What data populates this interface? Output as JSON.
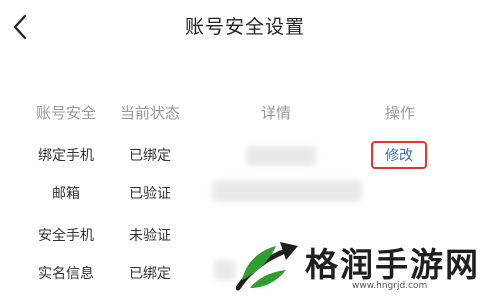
{
  "header": {
    "title": "账号安全设置",
    "back_icon": "chevron-left-icon"
  },
  "table": {
    "columns": [
      "账号安全",
      "当前状态",
      "详情",
      "操作"
    ],
    "rows": [
      {
        "item": "绑定手机",
        "status": "已绑定",
        "action": "修改"
      },
      {
        "item": "邮箱",
        "status": "已验证"
      },
      {
        "item": "安全手机",
        "status": "未验证"
      },
      {
        "item": "实名信息",
        "status": "已绑定"
      }
    ]
  },
  "watermark": {
    "text": "格润手游网",
    "url": "www.hngrjd.com",
    "logo_icon": "arrow-leaf-logo"
  },
  "colors": {
    "action_text": "#3a6fcf",
    "action_highlight_border": "#e2352d",
    "logo_green": "#2f9e2f"
  }
}
